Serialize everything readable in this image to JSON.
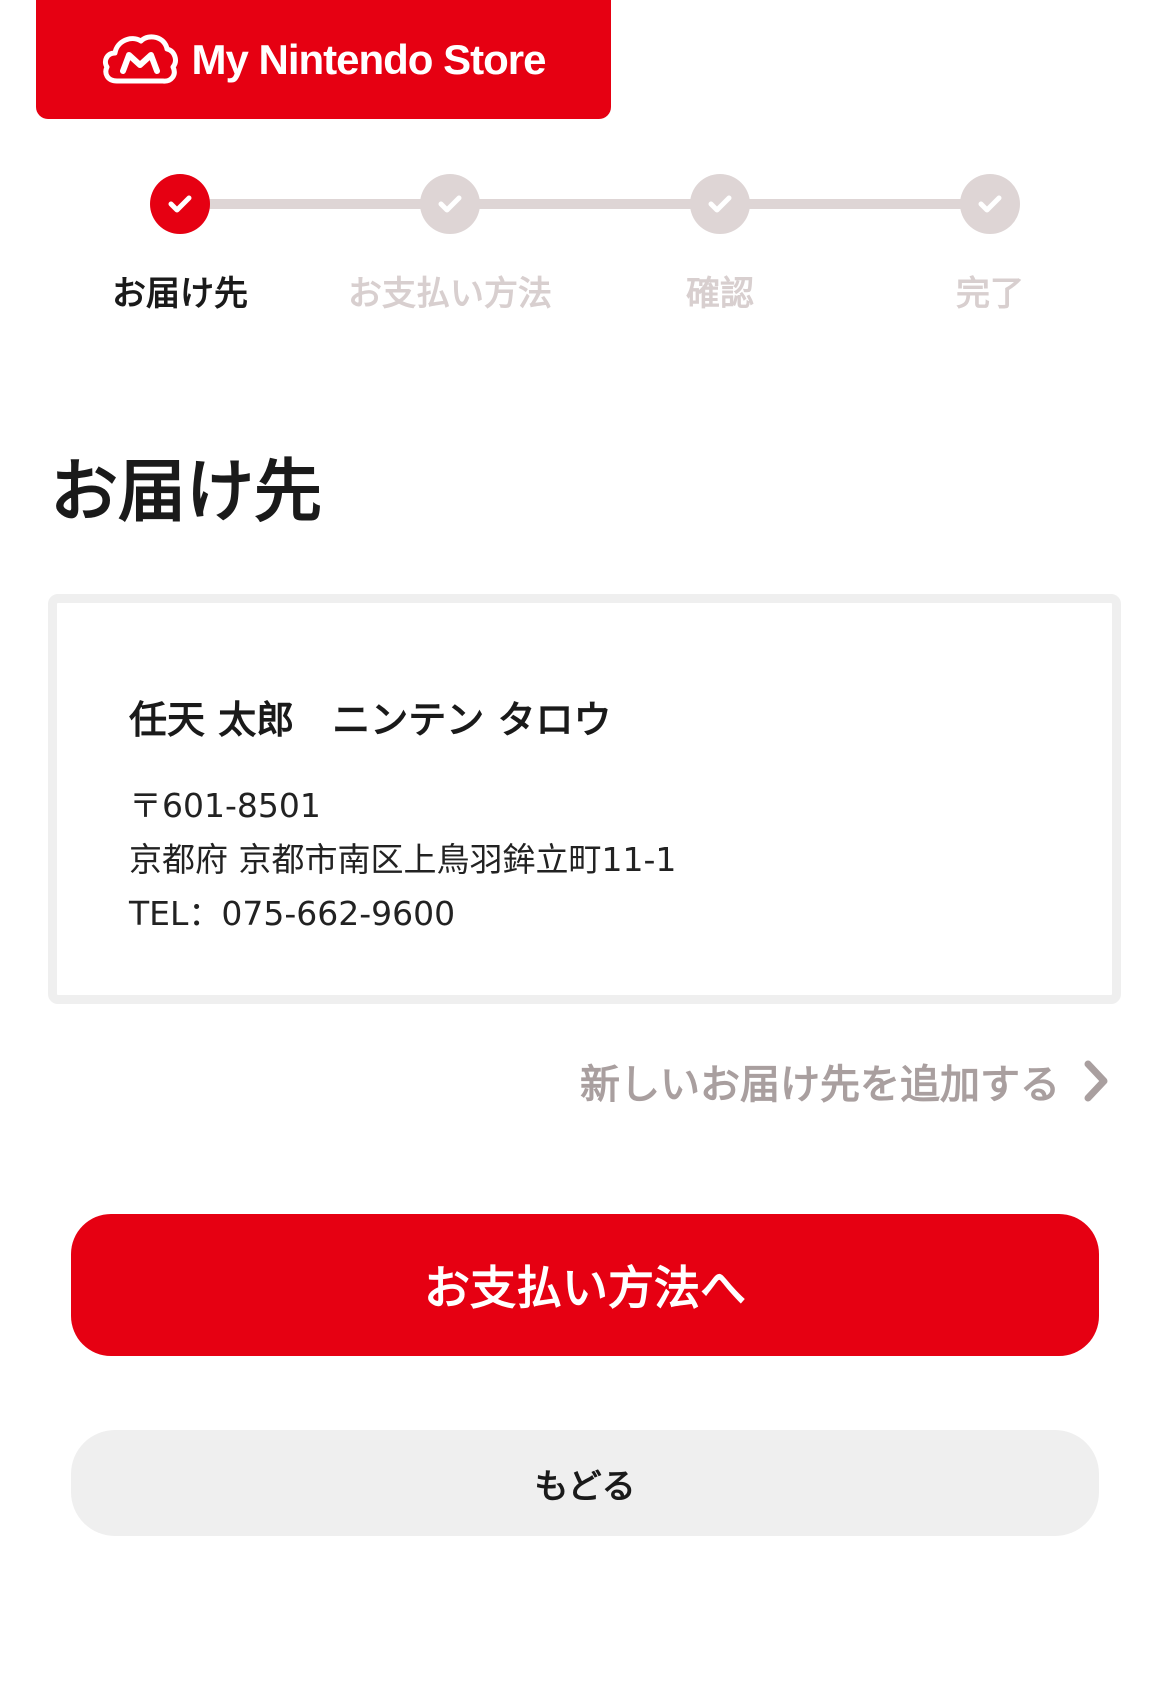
{
  "brand": {
    "name": "My Nintendo Store",
    "logo_icon": "mario-cap-cloud-icon",
    "color": "#e60012"
  },
  "steps": [
    {
      "label": "お届け先",
      "status": "active"
    },
    {
      "label": "お支払い方法",
      "status": "inactive"
    },
    {
      "label": "確認",
      "status": "inactive"
    },
    {
      "label": "完了",
      "status": "inactive"
    }
  ],
  "page_title": "お届け先",
  "address": {
    "name": "任天 太郎　ニンテン タロウ",
    "postal": "〒601-8501",
    "street": "京都府 京都市南区上鳥羽鉾立町11-1",
    "tel": "TEL：075-662-9600"
  },
  "add_address_link": "新しいお届け先を追加する",
  "primary_button": "お支払い方法へ",
  "back_button": "もどる",
  "colors": {
    "accent": "#e60012",
    "inactive": "#ded5d5",
    "link_gray": "#a99f9f"
  }
}
